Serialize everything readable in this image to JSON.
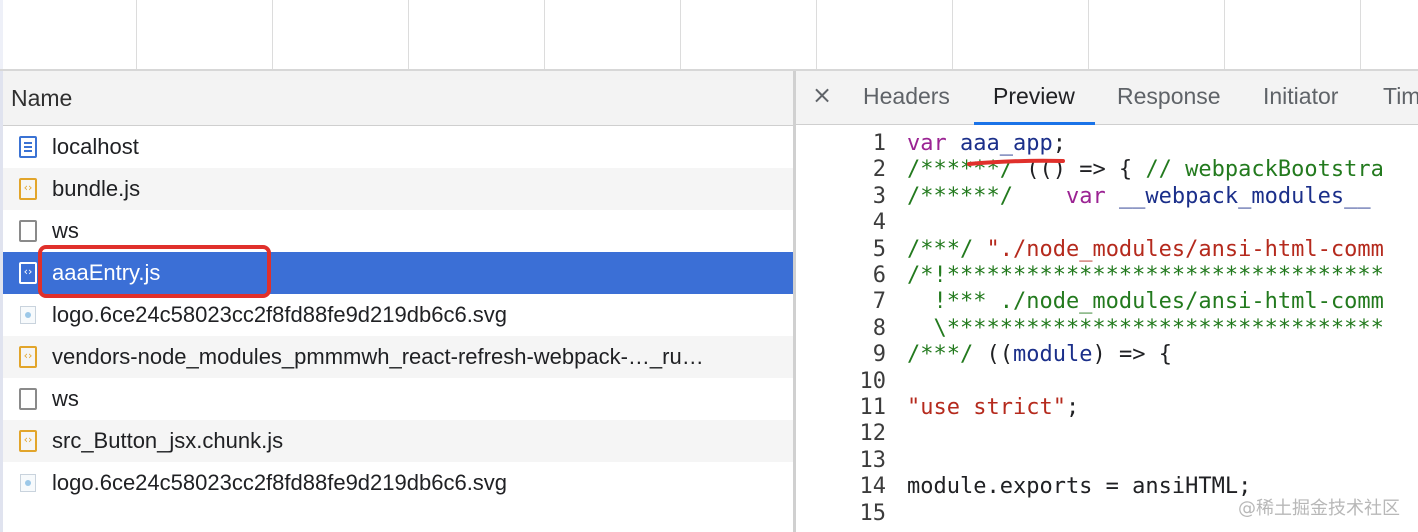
{
  "left_panel": {
    "header": "Name",
    "rows": [
      {
        "label": "localhost",
        "icon": "document-icon",
        "type": "doc"
      },
      {
        "label": "bundle.js",
        "icon": "script-icon",
        "type": "js"
      },
      {
        "label": "ws",
        "icon": "websocket-icon",
        "type": "blank"
      },
      {
        "label": "aaaEntry.js",
        "icon": "script-icon",
        "type": "js",
        "selected": true
      },
      {
        "label": "logo.6ce24c58023cc2f8fd88fe9d219db6c6.svg",
        "icon": "image-icon",
        "type": "img"
      },
      {
        "label": "vendors-node_modules_pmmmwh_react-refresh-webpack-…_ru…",
        "icon": "script-icon",
        "type": "js"
      },
      {
        "label": "ws",
        "icon": "websocket-icon",
        "type": "blank"
      },
      {
        "label": "src_Button_jsx.chunk.js",
        "icon": "script-icon",
        "type": "js"
      },
      {
        "label": "logo.6ce24c58023cc2f8fd88fe9d219db6c6.svg",
        "icon": "image-icon",
        "type": "img"
      }
    ]
  },
  "right_panel": {
    "close": "×",
    "tabs": [
      {
        "label": "Headers"
      },
      {
        "label": "Preview",
        "active": true
      },
      {
        "label": "Response"
      },
      {
        "label": "Initiator"
      },
      {
        "label": "Tim"
      }
    ],
    "code_lines": [
      {
        "n": "1",
        "parts": [
          [
            "kw",
            "var "
          ],
          [
            "id",
            "aaa_app"
          ],
          [
            "",
            "; "
          ]
        ]
      },
      {
        "n": "2",
        "parts": [
          [
            "cm",
            "/******/ "
          ],
          [
            "",
            "(() => { "
          ],
          [
            "cm",
            "// webpackBootstra"
          ]
        ]
      },
      {
        "n": "3",
        "parts": [
          [
            "cm",
            "/******/"
          ],
          [
            "",
            "    "
          ],
          [
            "kw",
            "var "
          ],
          [
            "id",
            "__webpack_modules__ "
          ]
        ]
      },
      {
        "n": "4",
        "parts": []
      },
      {
        "n": "5",
        "parts": [
          [
            "cm",
            "/***/ "
          ],
          [
            "st",
            "\"./node_modules/ansi-html-comm"
          ]
        ]
      },
      {
        "n": "6",
        "parts": [
          [
            "cm",
            "/*!*********************************"
          ]
        ]
      },
      {
        "n": "7",
        "parts": [
          [
            "cm",
            "  !*** ./node_modules/ansi-html-comm"
          ]
        ]
      },
      {
        "n": "8",
        "parts": [
          [
            "cm",
            "  \\*********************************"
          ]
        ]
      },
      {
        "n": "9",
        "parts": [
          [
            "cm",
            "/***/ "
          ],
          [
            "",
            "(("
          ],
          [
            "id",
            "module"
          ],
          [
            "",
            ") => {"
          ]
        ]
      },
      {
        "n": "10",
        "parts": []
      },
      {
        "n": "11",
        "parts": [
          [
            "st",
            "\"use strict\""
          ],
          [
            "",
            ";"
          ]
        ]
      },
      {
        "n": "12",
        "parts": []
      },
      {
        "n": "13",
        "parts": []
      },
      {
        "n": "14",
        "parts": [
          [
            "",
            "module.exports = ansiHTML;"
          ]
        ]
      },
      {
        "n": "15",
        "parts": []
      }
    ]
  },
  "watermark": "@稀土掘金技术社区",
  "colors": {
    "selected_row": "#3b6fd6",
    "annotation_red": "#e0302b",
    "active_tab_underline": "#1a73e8"
  }
}
